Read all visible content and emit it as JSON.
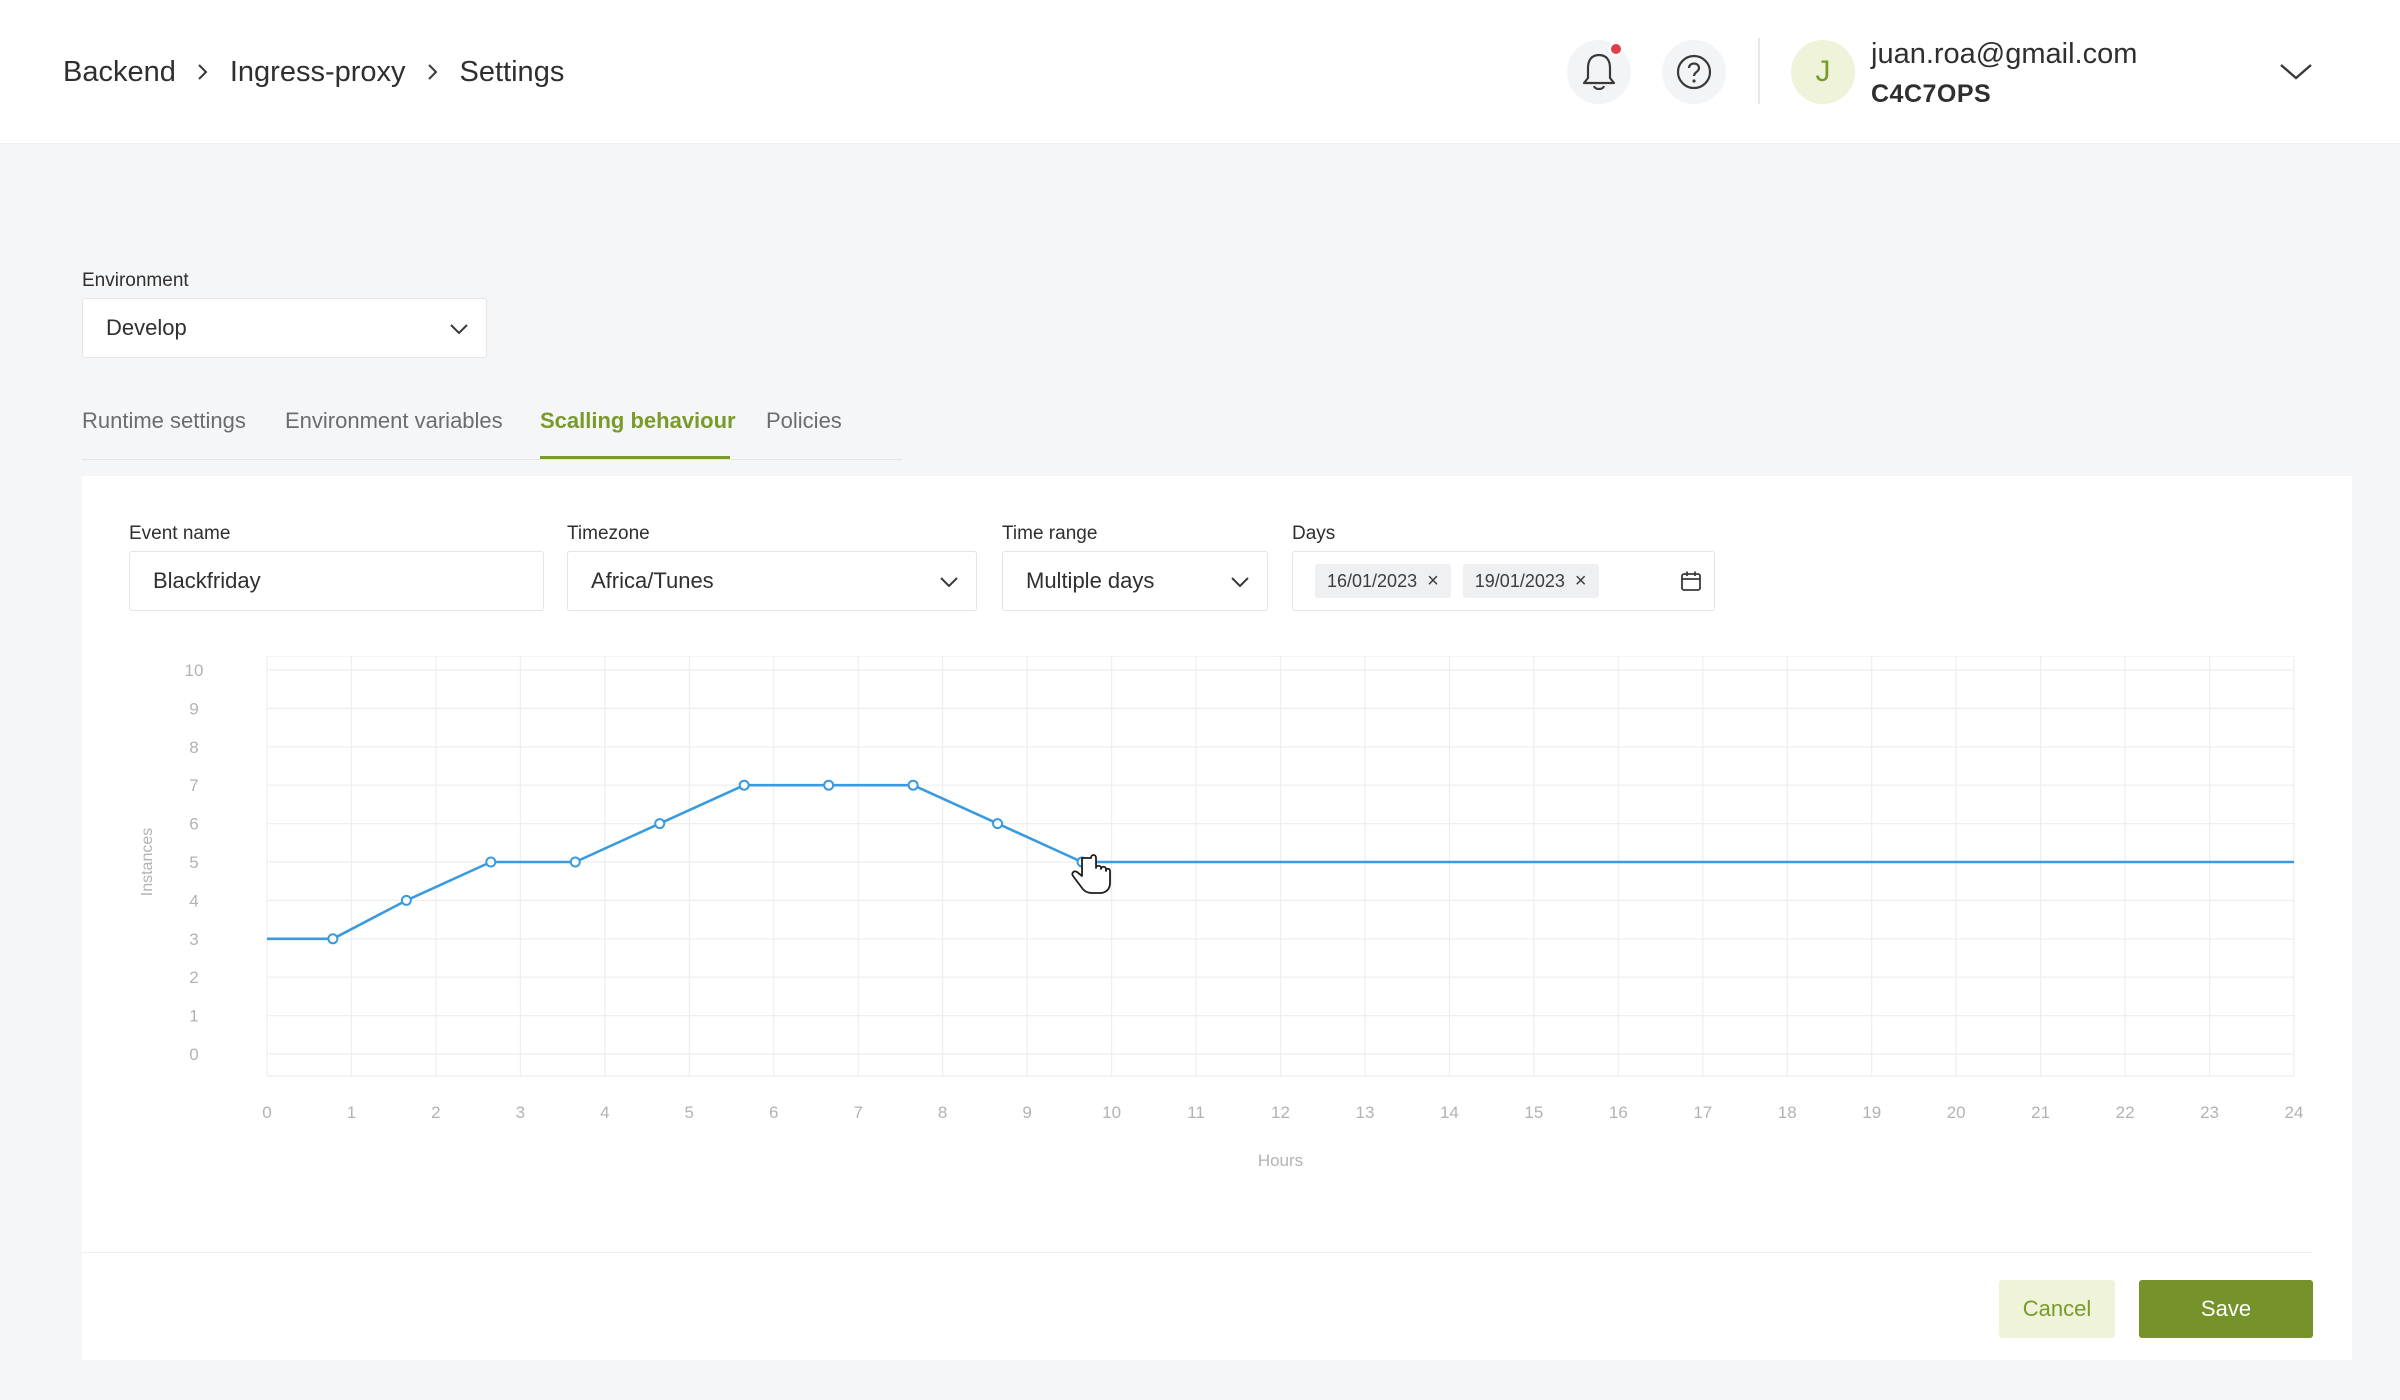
{
  "breadcrumb": [
    "Backend",
    "Ingress-proxy",
    "Settings"
  ],
  "header": {
    "user_initial": "J",
    "user_email": "juan.roa@gmail.com",
    "org": "C4C7OPS"
  },
  "environment": {
    "label": "Environment",
    "value": "Develop"
  },
  "tabs": [
    {
      "label": "Runtime settings",
      "active": false
    },
    {
      "label": "Environment variables",
      "active": false
    },
    {
      "label": "Scalling behaviour",
      "active": true
    },
    {
      "label": "Policies",
      "active": false
    }
  ],
  "form": {
    "event_name": {
      "label": "Event name",
      "value": "Blackfriday"
    },
    "timezone": {
      "label": "Timezone",
      "value": "Africa/Tunes"
    },
    "time_range": {
      "label": "Time range",
      "value": "Multiple days"
    },
    "days": {
      "label": "Days",
      "chips": [
        "16/01/2023",
        "19/01/2023"
      ]
    }
  },
  "chart_data": {
    "type": "line",
    "xlabel": "Hours",
    "ylabel": "Instances",
    "xlim": [
      0,
      24
    ],
    "ylim": [
      0,
      10
    ],
    "x_ticks": [
      0,
      1,
      2,
      3,
      4,
      5,
      6,
      7,
      8,
      9,
      10,
      11,
      12,
      13,
      14,
      15,
      16,
      17,
      18,
      19,
      20,
      21,
      22,
      23,
      24
    ],
    "y_ticks": [
      0,
      1,
      2,
      3,
      4,
      5,
      6,
      7,
      8,
      9,
      10
    ],
    "grid": true,
    "line_color": "#3a9ae0",
    "points": [
      {
        "x": 0,
        "y": 3
      },
      {
        "x": 0.78,
        "y": 3
      },
      {
        "x": 1.65,
        "y": 4
      },
      {
        "x": 2.65,
        "y": 5
      },
      {
        "x": 3.65,
        "y": 5
      },
      {
        "x": 4.65,
        "y": 6
      },
      {
        "x": 5.65,
        "y": 7
      },
      {
        "x": 6.65,
        "y": 7
      },
      {
        "x": 7.65,
        "y": 7
      },
      {
        "x": 8.65,
        "y": 6
      },
      {
        "x": 9.65,
        "y": 5
      },
      {
        "x": 24,
        "y": 5
      }
    ],
    "marker_points": [
      1,
      2,
      3,
      4,
      5,
      6,
      7,
      8,
      9,
      10
    ]
  },
  "actions": {
    "cancel": "Cancel",
    "save": "Save"
  },
  "colors": {
    "accent": "#7a9a2a",
    "notification": "#e53b4a"
  }
}
